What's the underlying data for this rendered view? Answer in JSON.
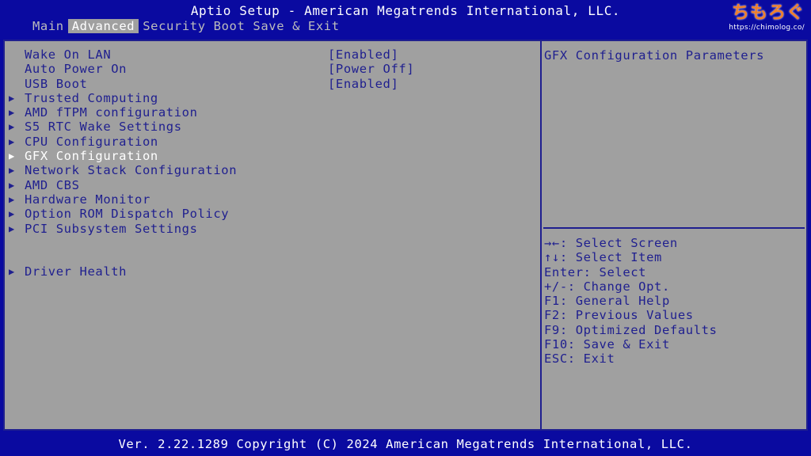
{
  "header": {
    "title": "Aptio Setup - American Megatrends International, LLC.",
    "watermark_logo": "ちもろぐ",
    "watermark_url": "https://chimolog.co/"
  },
  "tabs": [
    {
      "label": "Main",
      "active": false
    },
    {
      "label": "Advanced",
      "active": true
    },
    {
      "label": "Security",
      "active": false
    },
    {
      "label": "Boot",
      "active": false
    },
    {
      "label": "Save & Exit",
      "active": false
    }
  ],
  "settings": [
    {
      "label": "Wake On LAN",
      "value": "[Enabled]"
    },
    {
      "label": "Auto Power On",
      "value": "[Power Off]"
    },
    {
      "label": "USB Boot",
      "value": "[Enabled]"
    }
  ],
  "submenus": [
    {
      "label": "Trusted Computing"
    },
    {
      "label": "AMD fTPM configuration"
    },
    {
      "label": "S5 RTC Wake Settings"
    },
    {
      "label": "CPU Configuration"
    },
    {
      "label": "GFX Configuration",
      "selected": true
    },
    {
      "label": "Network Stack Configuration"
    },
    {
      "label": "AMD CBS"
    },
    {
      "label": "Hardware Monitor"
    },
    {
      "label": "Option ROM Dispatch Policy"
    },
    {
      "label": "PCI Subsystem Settings"
    }
  ],
  "driver_health": {
    "label": "Driver Health"
  },
  "submenu_arrow": "▶",
  "help": {
    "description": "GFX Configuration Parameters",
    "keys": [
      "→←: Select Screen",
      "↑↓: Select Item",
      "Enter: Select",
      "+/-: Change Opt.",
      "F1: General Help",
      "F2: Previous Values",
      "F9: Optimized Defaults",
      "F10: Save & Exit",
      "ESC: Exit"
    ]
  },
  "footer": {
    "text": "Ver. 2.22.1289 Copyright (C) 2024 American Megatrends International, LLC."
  },
  "colors": {
    "background": "#0a0aa0",
    "panel": "#a0a0a0",
    "text": "#1f1f8f",
    "highlight": "#ffffff",
    "logo": "#f07f2a"
  }
}
